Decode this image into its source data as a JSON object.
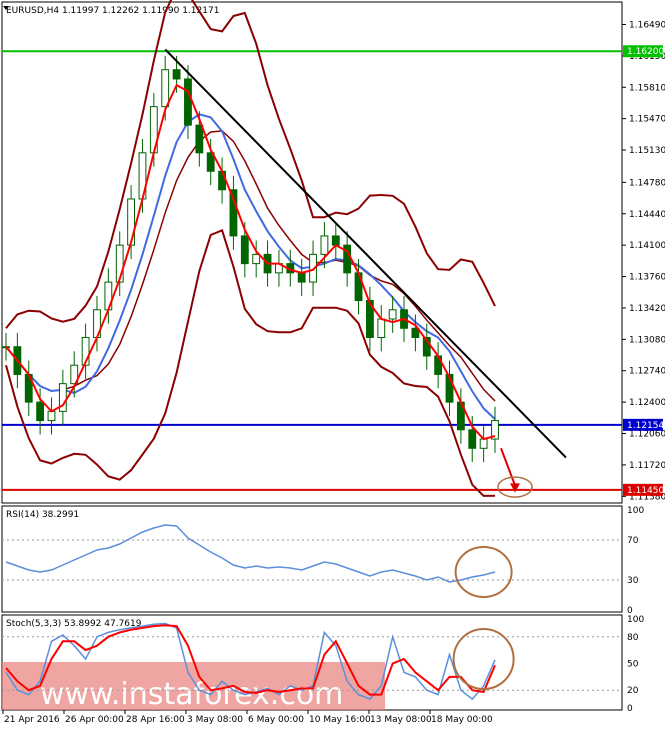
{
  "header": {
    "symbol_line": "EURUSD,H4  1.11997 1.12262 1.11990 1.12171",
    "rsi_label": "RSI(14) 38.2991",
    "stoch_label": "Stoch(5,3,3) 53.8992 47.7619",
    "watermark": "www.instaforex.com"
  },
  "colors": {
    "candle": "#006400",
    "bb": "#8b0000",
    "ma_fast": "#ff0000",
    "ma_slow": "#4169e1",
    "trend": "#000000",
    "res": "#00c000",
    "cur": "#0000cd",
    "sup": "#dd0000",
    "circle": "#b07040",
    "rsi": "#5b8fdc",
    "stoch_main": "#5b8fdc",
    "stoch_sig": "#ff0000"
  },
  "chart_data": [
    {
      "type": "candlestick",
      "title": "EURUSD,H4",
      "ylim": [
        1.1134,
        1.1669
      ],
      "yticks": [
        "1.16490",
        "1.16150",
        "1.15810",
        "1.15470",
        "1.15130",
        "1.14780",
        "1.14440",
        "1.14100",
        "1.13760",
        "1.13420",
        "1.13080",
        "1.12740",
        "1.12400",
        "1.12060",
        "1.11720",
        "1.11380"
      ],
      "open": 1.11997,
      "high": 1.12262,
      "low": 1.1199,
      "close": 1.12171,
      "levels": [
        {
          "label": "1.16200",
          "value": 1.162,
          "color": "#00c000"
        },
        {
          "label": "1.12154",
          "value": 1.12154,
          "color": "#0000cd"
        },
        {
          "label": "1.11450",
          "value": 1.1145,
          "color": "#dd0000"
        }
      ],
      "close_series": [
        1.13,
        1.127,
        1.124,
        1.122,
        1.123,
        1.126,
        1.128,
        1.131,
        1.134,
        1.137,
        1.141,
        1.146,
        1.151,
        1.156,
        1.16,
        1.159,
        1.154,
        1.151,
        1.149,
        1.147,
        1.142,
        1.139,
        1.14,
        1.138,
        1.139,
        1.138,
        1.137,
        1.14,
        1.142,
        1.141,
        1.138,
        1.135,
        1.131,
        1.133,
        1.134,
        1.132,
        1.131,
        1.129,
        1.127,
        1.124,
        1.121,
        1.119,
        1.12,
        1.122
      ]
    },
    {
      "type": "line",
      "title": "RSI(14) 38.2991",
      "ylim": [
        0,
        100
      ],
      "yticks": [
        "100",
        "70",
        "30",
        "0"
      ],
      "series": [
        {
          "values": [
            48,
            44,
            40,
            38,
            40,
            45,
            50,
            55,
            60,
            62,
            66,
            72,
            78,
            82,
            85,
            84,
            72,
            65,
            58,
            52,
            45,
            42,
            44,
            42,
            43,
            42,
            40,
            44,
            48,
            46,
            42,
            38,
            34,
            38,
            40,
            37,
            34,
            30,
            33,
            28,
            30,
            33,
            35,
            38
          ]
        }
      ]
    },
    {
      "type": "line",
      "title": "Stoch(5,3,3) 53.8992 47.7619",
      "ylim": [
        0,
        100
      ],
      "yticks": [
        "100",
        "80",
        "50",
        "20",
        "0"
      ],
      "series": [
        {
          "values": [
            40,
            20,
            15,
            30,
            75,
            82,
            70,
            55,
            80,
            85,
            88,
            90,
            92,
            94,
            95,
            90,
            40,
            20,
            15,
            30,
            20,
            15,
            18,
            22,
            15,
            25,
            20,
            25,
            85,
            70,
            30,
            15,
            10,
            25,
            80,
            40,
            35,
            20,
            15,
            60,
            20,
            10,
            25,
            54
          ]
        },
        {
          "values": [
            45,
            30,
            20,
            25,
            55,
            75,
            75,
            65,
            70,
            80,
            85,
            88,
            90,
            92,
            93,
            92,
            70,
            35,
            20,
            22,
            25,
            18,
            17,
            20,
            18,
            20,
            22,
            22,
            60,
            75,
            50,
            25,
            15,
            15,
            50,
            55,
            40,
            30,
            20,
            35,
            35,
            20,
            18,
            48
          ]
        }
      ]
    }
  ],
  "xaxis": {
    "labels": [
      "21 Apr 2016",
      "26 Apr 00:00",
      "28 Apr 16:00",
      "3 May 08:00",
      "6 May 00:00",
      "10 May 16:00",
      "13 May 08:00",
      "18 May 00:00"
    ]
  }
}
